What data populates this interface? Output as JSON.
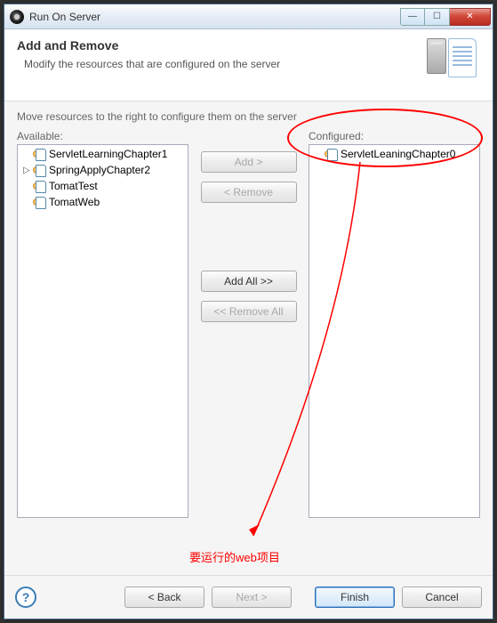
{
  "window": {
    "title": "Run On Server"
  },
  "header": {
    "title": "Add and Remove",
    "subtitle": "Modify the resources that are configured on the server"
  },
  "instructions": "Move resources to the right to configure them on the server",
  "labels": {
    "available": "Available:",
    "configured": "Configured:"
  },
  "available_items": [
    {
      "label": "ServletLearningChapter1",
      "expandable": false
    },
    {
      "label": "SpringApplyChapter2",
      "expandable": true
    },
    {
      "label": "TomatTest",
      "expandable": false
    },
    {
      "label": "TomatWeb",
      "expandable": false
    }
  ],
  "configured_items": [
    {
      "label": "ServletLeaningChapter0",
      "expandable": false
    }
  ],
  "buttons": {
    "add": "Add >",
    "remove": "< Remove",
    "add_all": "Add All >>",
    "remove_all": "<< Remove All",
    "back": "< Back",
    "next": "Next >",
    "finish": "Finish",
    "cancel": "Cancel"
  },
  "button_state": {
    "add": "disabled",
    "remove": "disabled",
    "add_all": "enabled",
    "remove_all": "disabled",
    "next": "disabled"
  },
  "annotation": {
    "text": "要运行的web项目"
  }
}
